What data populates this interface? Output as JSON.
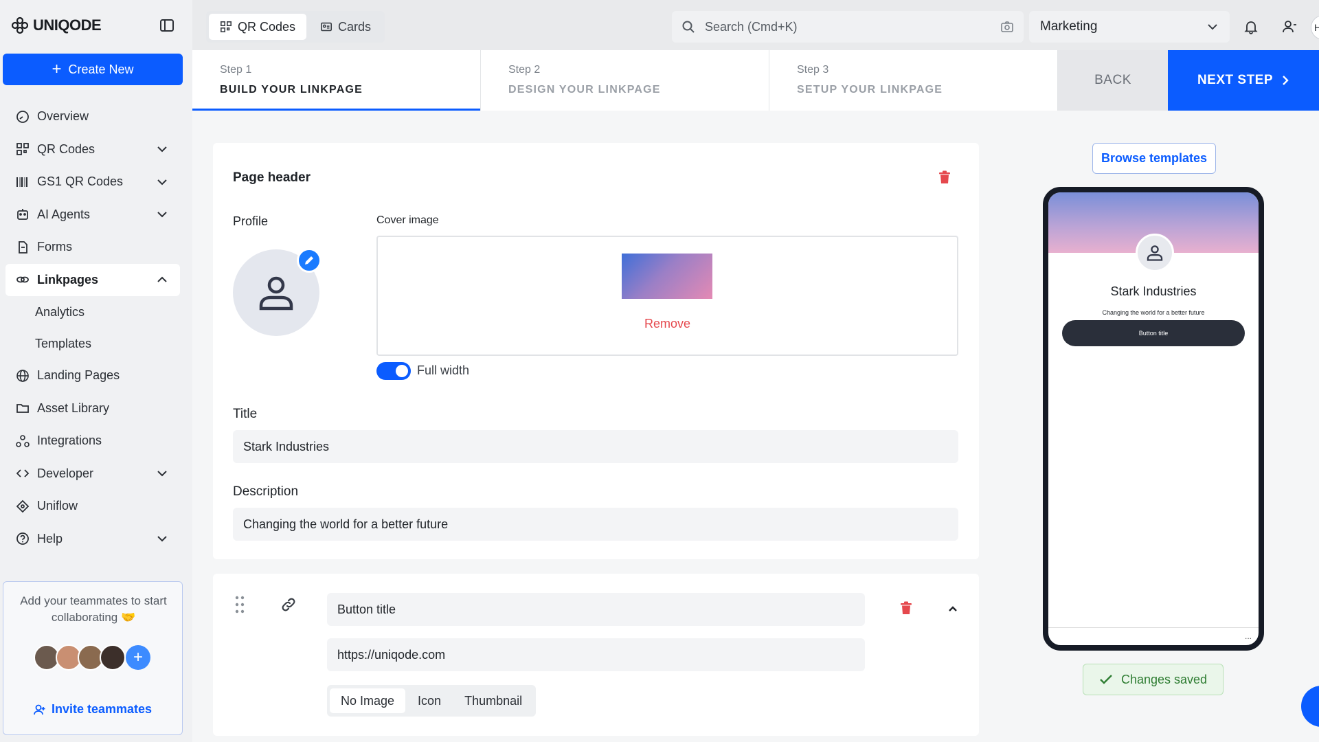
{
  "app": {
    "brand": "UNIQODE"
  },
  "sidebar": {
    "create_label": "Create New",
    "items": [
      {
        "label": "Overview",
        "icon": "gauge-icon"
      },
      {
        "label": "QR Codes",
        "icon": "qr-icon"
      },
      {
        "label": "GS1 QR Codes",
        "icon": "barcode-icon"
      },
      {
        "label": "AI Agents",
        "icon": "robot-icon"
      },
      {
        "label": "Forms",
        "icon": "form-icon"
      },
      {
        "label": "Linkpages",
        "icon": "link-icon"
      },
      {
        "label": "Analytics"
      },
      {
        "label": "Templates"
      },
      {
        "label": "Landing Pages",
        "icon": "globe-icon"
      },
      {
        "label": "Asset Library",
        "icon": "folder-icon"
      },
      {
        "label": "Integrations",
        "icon": "integrations-icon"
      },
      {
        "label": "Developer",
        "icon": "code-icon"
      },
      {
        "label": "Uniflow",
        "icon": "uniflow-icon"
      },
      {
        "label": "Help",
        "icon": "help-icon"
      }
    ],
    "team": {
      "text": "Add your teammates to start collaborating 🤝",
      "invite_label": "Invite teammates"
    }
  },
  "topbar": {
    "tabs": [
      {
        "label": "QR Codes",
        "active": true
      },
      {
        "label": "Cards",
        "active": false
      }
    ],
    "search_placeholder": "Search (Cmd+K)",
    "workspace": "Marketing",
    "edge_text": "H"
  },
  "steps": [
    {
      "num": "Step 1",
      "title": "BUILD YOUR LINKPAGE",
      "active": true
    },
    {
      "num": "Step 2",
      "title": "DESIGN YOUR LINKPAGE",
      "active": false
    },
    {
      "num": "Step 3",
      "title": "SETUP YOUR LINKPAGE",
      "active": false
    }
  ],
  "actions": {
    "back": "BACK",
    "next": "NEXT STEP"
  },
  "header_card": {
    "title": "Page header",
    "profile_label": "Profile",
    "cover_label": "Cover image",
    "remove_label": "Remove",
    "full_width_label": "Full width",
    "full_width_on": true,
    "title_label": "Title",
    "title_value": "Stark Industries",
    "description_label": "Description",
    "description_value": "Changing the world for a better future"
  },
  "button_card": {
    "title_value": "Button title",
    "url_value": "https://uniqode.com",
    "image_options": [
      "No Image",
      "Icon",
      "Thumbnail"
    ],
    "selected_option": "No Image"
  },
  "preview": {
    "browse_label": "Browse templates",
    "name": "Stark Industries",
    "description": "Changing the world for a better future",
    "button": "Button title",
    "more": "..."
  },
  "status": {
    "saved": "Changes saved"
  },
  "colors": {
    "accent": "#0b5cff",
    "danger": "#e5484d",
    "success": "#2e7d32"
  }
}
